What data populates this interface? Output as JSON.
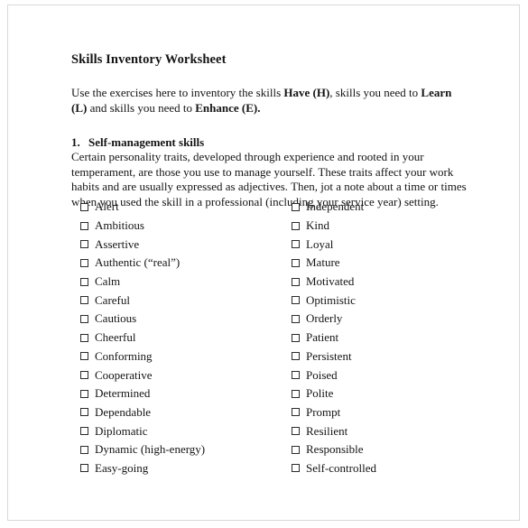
{
  "document": {
    "title": "Skills Inventory Worksheet",
    "intro": {
      "segments": [
        {
          "text": "Use the exercises here to inventory the skills ",
          "bold": false
        },
        {
          "text": "Have (H)",
          "bold": true
        },
        {
          "text": ", skills you need to ",
          "bold": false
        },
        {
          "text": "Learn (L)",
          "bold": true
        },
        {
          "text": " and skills you need to ",
          "bold": false
        },
        {
          "text": "Enhance (E).",
          "bold": true
        }
      ]
    },
    "section": {
      "number": "1.",
      "heading": "Self-management skills",
      "paragraph": "Certain personality traits, developed through experience and rooted in your temperament, are those you use to manage yourself.  These traits affect your work habits and are usually expressed as adjectives. Then, jot a note about a time or times when you used the skill in a professional (including your service year) setting."
    },
    "checklist": {
      "left_column": [
        {
          "label": "Alert",
          "checked": false
        },
        {
          "label": "Ambitious",
          "checked": false
        },
        {
          "label": "Assertive",
          "checked": false
        },
        {
          "label": "Authentic (“real”)",
          "checked": false
        },
        {
          "label": "Calm",
          "checked": false
        },
        {
          "label": "Careful",
          "checked": false
        },
        {
          "label": "Cautious",
          "checked": false
        },
        {
          "label": "Cheerful",
          "checked": false
        },
        {
          "label": "Conforming",
          "checked": false
        },
        {
          "label": "Cooperative",
          "checked": false
        },
        {
          "label": "Determined",
          "checked": false
        },
        {
          "label": "Dependable",
          "checked": false
        },
        {
          "label": "Diplomatic",
          "checked": false
        },
        {
          "label": "Dynamic (high-energy)",
          "checked": false
        },
        {
          "label": "Easy-going",
          "checked": false
        }
      ],
      "right_column": [
        {
          "label": "Independent",
          "checked": false
        },
        {
          "label": "Kind",
          "checked": false
        },
        {
          "label": "Loyal",
          "checked": false
        },
        {
          "label": "Mature",
          "checked": false
        },
        {
          "label": "Motivated",
          "checked": false
        },
        {
          "label": "Optimistic",
          "checked": false
        },
        {
          "label": "Orderly",
          "checked": false
        },
        {
          "label": "Patient",
          "checked": false
        },
        {
          "label": "Persistent",
          "checked": false
        },
        {
          "label": "Poised",
          "checked": false
        },
        {
          "label": "Polite",
          "checked": false
        },
        {
          "label": "Prompt",
          "checked": false
        },
        {
          "label": "Resilient",
          "checked": false
        },
        {
          "label": "Responsible",
          "checked": false
        },
        {
          "label": "Self-controlled",
          "checked": false
        }
      ]
    }
  },
  "colors": {
    "text": "#141414",
    "page_background": "#ffffff",
    "page_border": "#d9d9d9",
    "checkbox_border": "#2b2b2b"
  }
}
